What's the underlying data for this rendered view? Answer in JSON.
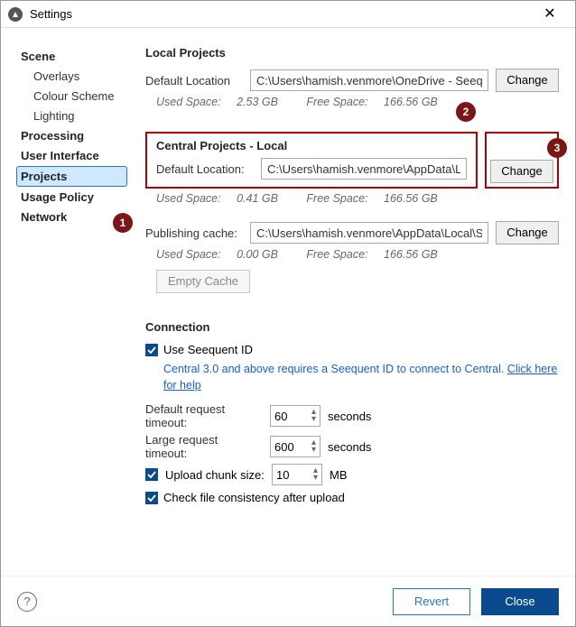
{
  "window": {
    "title": "Settings"
  },
  "sidebar": {
    "items": [
      {
        "label": "Scene"
      },
      {
        "label": "Overlays"
      },
      {
        "label": "Colour Scheme"
      },
      {
        "label": "Lighting"
      },
      {
        "label": "Processing"
      },
      {
        "label": "User Interface"
      },
      {
        "label": "Projects"
      },
      {
        "label": "Usage Policy"
      },
      {
        "label": "Network"
      }
    ]
  },
  "callouts": {
    "c1": "1",
    "c2": "2",
    "c3": "3"
  },
  "local": {
    "heading": "Local Projects",
    "label": "Default Location",
    "path": "C:\\Users\\hamish.venmore\\OneDrive - Seequent\\",
    "change": "Change",
    "used_lbl": "Used Space:",
    "used": "2.53 GB",
    "free_lbl": "Free Space:",
    "free": "166.56 GB"
  },
  "central": {
    "heading": "Central Projects - Local",
    "label": "Default Location:",
    "path": "C:\\Users\\hamish.venmore\\AppData\\Local\\ARA",
    "change": "Change",
    "used_lbl": "Used Space:",
    "used": "0.41 GB",
    "free_lbl": "Free Space:",
    "free": "166.56 GB"
  },
  "pubcache": {
    "label": "Publishing cache:",
    "path": "C:\\Users\\hamish.venmore\\AppData\\Local\\See",
    "change": "Change",
    "used_lbl": "Used Space:",
    "used": "0.00 GB",
    "free_lbl": "Free Space:",
    "free": "166.56 GB",
    "empty": "Empty Cache"
  },
  "connection": {
    "heading": "Connection",
    "use_seequent": "Use Seequent ID",
    "info_pre": "Central 3.0 and above requires a Seequent ID to connect to Central. ",
    "info_link": "Click here for help",
    "def_timeout_lbl": "Default request timeout:",
    "def_timeout": "60",
    "large_timeout_lbl": "Large request timeout:",
    "large_timeout": "600",
    "seconds": "seconds",
    "chunk_lbl": "Upload chunk size:",
    "chunk": "10",
    "mb": "MB",
    "check_consistency": "Check file consistency after upload"
  },
  "footer": {
    "revert": "Revert",
    "close": "Close"
  }
}
